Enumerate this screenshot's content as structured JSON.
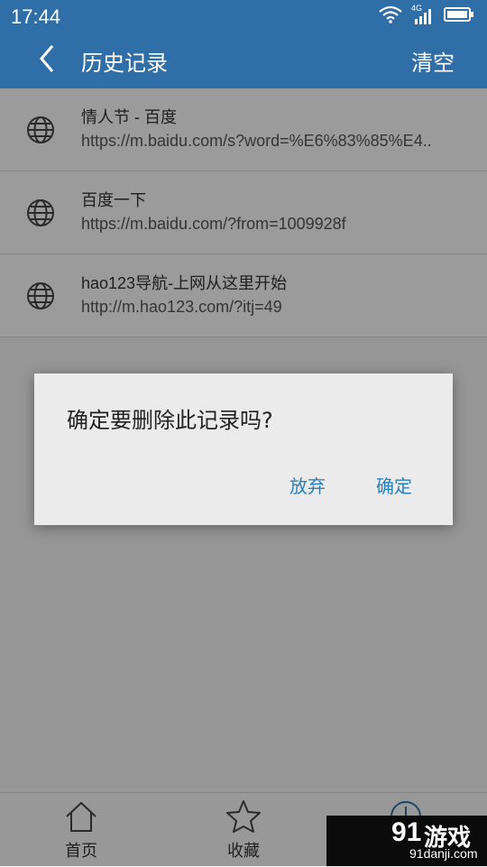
{
  "status_bar": {
    "time": "17:44",
    "network_label": "4G",
    "icons": [
      "wifi-icon",
      "signal-icon",
      "battery-icon"
    ]
  },
  "app_bar": {
    "title": "历史记录",
    "action_label": "清空",
    "back_icon": "chevron-left-icon"
  },
  "history": [
    {
      "title": "情人节 - 百度",
      "url": "https://m.baidu.com/s?word=%E6%83%85%E4..",
      "icon": "globe-icon"
    },
    {
      "title": "百度一下",
      "url": "https://m.baidu.com/?from=1009928f",
      "icon": "globe-icon"
    },
    {
      "title": "hao123导航-上网从这里开始",
      "url": "http://m.hao123.com/?itj=49",
      "icon": "globe-icon"
    }
  ],
  "dialog": {
    "message": "确定要删除此记录吗?",
    "cancel_label": "放弃",
    "confirm_label": "确定"
  },
  "bottom_nav": [
    {
      "label": "首页",
      "icon": "home-icon"
    },
    {
      "label": "收藏",
      "icon": "star-icon"
    },
    {
      "label": "",
      "icon": "clock-icon"
    }
  ],
  "watermark": {
    "number": "91",
    "text": "游戏",
    "url": "91danji.com"
  },
  "colors": {
    "primary": "#2f6ea6",
    "dialog_button": "#2a7fb6",
    "overlay": "rgba(0,0,0,0.38)"
  }
}
